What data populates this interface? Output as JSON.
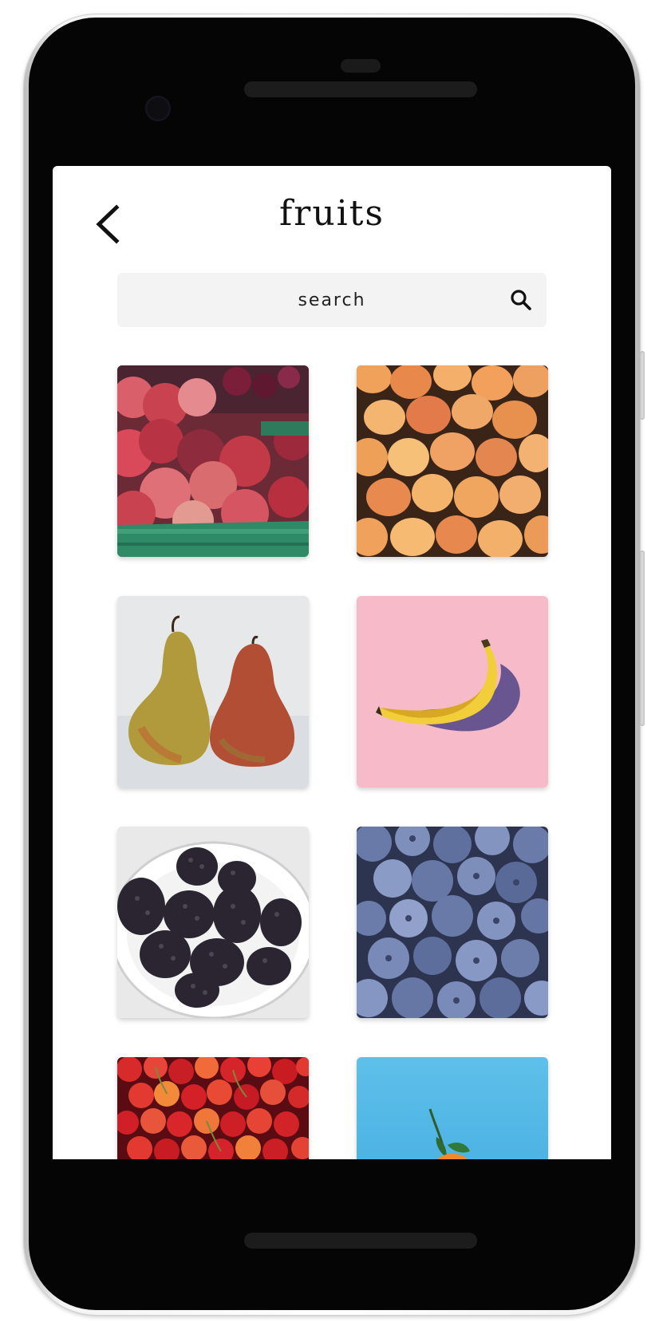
{
  "header": {
    "title": "fruits"
  },
  "search": {
    "placeholder": "search"
  },
  "tiles": [
    {
      "fruit": "apples"
    },
    {
      "fruit": "apricots"
    },
    {
      "fruit": "pears"
    },
    {
      "fruit": "banana"
    },
    {
      "fruit": "blackberries"
    },
    {
      "fruit": "blueberries"
    },
    {
      "fruit": "cherries"
    },
    {
      "fruit": "orange"
    }
  ],
  "icons": {
    "back": "chevron-left-icon",
    "search": "search-icon"
  },
  "colors": {
    "screen_background": "#ffffff",
    "search_background": "#f3f3f3",
    "text": "#111111",
    "phone_body": "#050505"
  }
}
